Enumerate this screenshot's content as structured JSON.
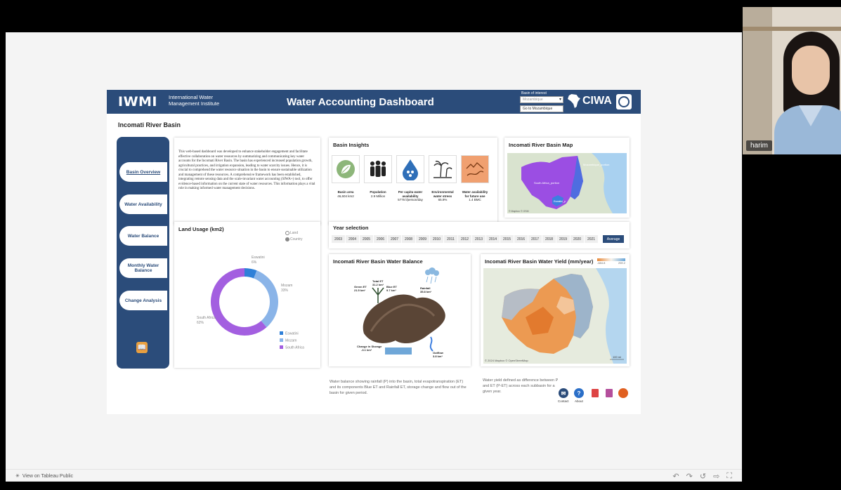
{
  "video": {
    "participant_name": "harim"
  },
  "footer": {
    "view_on_tableau": "View on Tableau Public",
    "controls": [
      "↶",
      "↷",
      "↺",
      "⇨",
      "⛶"
    ]
  },
  "header": {
    "iwmi_logo": "IWMI",
    "iwmi_name": "International Water Management Institute",
    "title": "Water Accounting Dashboard",
    "basin_label": "Basin of interest",
    "basin_value": "Mozambique",
    "goto_label": "Go to Mozambique",
    "ciwa_logo": "CIWA"
  },
  "page_title": "Incomati River Basin",
  "nav": [
    {
      "label": "Basin Overview",
      "active": true
    },
    {
      "label": "Water Availability"
    },
    {
      "label": "Water Balance"
    },
    {
      "label": "Monthly Water Balance"
    },
    {
      "label": "Change Analysis"
    }
  ],
  "intro": {
    "text": "This web-based dashboard was developed to enhance stakeholder engagement and facilitate effective collaboration on water resources by summarizing and communicating key water accounts for the Incomati River Basin. The basin has experienced increased population growth, agricultural practices, and irrigation expansion, leading to water scarcity issues. Hence, it is crucial to comprehend the water resource situation in the basin to ensure sustainable utilization and management of these resources. A comprehensive framework has been established, integrating remote sensing data and the scale-invariant water accounting (SIWA+) tool, to offer evidence-based information on the current state of water resources. This information plays a vital role in making informed water management decisions."
  },
  "insights": {
    "title": "Basin Insights",
    "items": [
      {
        "name": "Basin area",
        "value": "46,604 km2",
        "icon": "leaf-icon",
        "color": "#8db67a"
      },
      {
        "name": "Population",
        "value": "2.9 Million",
        "icon": "people-icon",
        "color": "#222222"
      },
      {
        "name": "Per capita water availability",
        "value": "5776 l/person/day",
        "icon": "water-drop-icon",
        "color": "#2f6fb8"
      },
      {
        "name": "Environmental water stress",
        "value": "65.9%",
        "icon": "palm-tree-icon",
        "color": "#333333"
      },
      {
        "name": "Water availability for future use",
        "value": "1.4 BMC",
        "icon": "river-icon",
        "color": "#f0a070"
      }
    ]
  },
  "basin_map": {
    "title": "Incomati River Basin Map",
    "labels": [
      "Mozambique_portion",
      "South Africa_portion",
      "Eswatini_p"
    ],
    "credit": "© Mapbox © OSM"
  },
  "land_usage": {
    "title": "Land Usage (km2)",
    "radio_options": [
      "Land",
      "Country"
    ],
    "selected": "Country"
  },
  "chart_data": {
    "type": "pie",
    "title": "Land Usage (km2)",
    "categories": [
      "Eswatini",
      "Mozam",
      "South Africa"
    ],
    "values": [
      6,
      33,
      62
    ],
    "colors": [
      "#2f80d8",
      "#8ab4e8",
      "#a35fe0"
    ],
    "legend_position": "bottom-right"
  },
  "year_selection": {
    "title": "Year selection",
    "years": [
      "2003",
      "2004",
      "2005",
      "2006",
      "2007",
      "2008",
      "2009",
      "2010",
      "2011",
      "2012",
      "2013",
      "2014",
      "2015",
      "2016",
      "2017",
      "2018",
      "2019",
      "2020",
      "2021"
    ],
    "average_label": "Average"
  },
  "water_balance": {
    "title": "Incomati River Basin Water Balance",
    "labels": [
      {
        "name": "Rainfall",
        "value": "35.8 km³"
      },
      {
        "name": "Total ET",
        "value": "31.2 km³"
      },
      {
        "name": "Green ET",
        "value": "21.5 km³"
      },
      {
        "name": "Blue ET",
        "value": "9.7 km³"
      },
      {
        "name": "Change in Storage",
        "value": "-3.1 km³"
      },
      {
        "name": "Outflow",
        "value": "3.8 km³"
      }
    ],
    "caption": "Water balance showing rainfall (P) into the basin, total evapotranspiration (ET) and its components Blue ET and Rainfall ET, storage change and flow out of the basin for given period."
  },
  "water_yield": {
    "title": "Incomati River Basin Water Yield (mm/year)",
    "legend_min": "-684.8",
    "legend_max": "259.2",
    "credit": "© 2024 Mapbox © OpenStreetMap",
    "scale": "100 mi",
    "caption": "Water yield defined as difference between P and ET (P-ET) across each subbasin for a given year."
  },
  "footer_icons": {
    "contact": "Contact",
    "about": "About"
  }
}
